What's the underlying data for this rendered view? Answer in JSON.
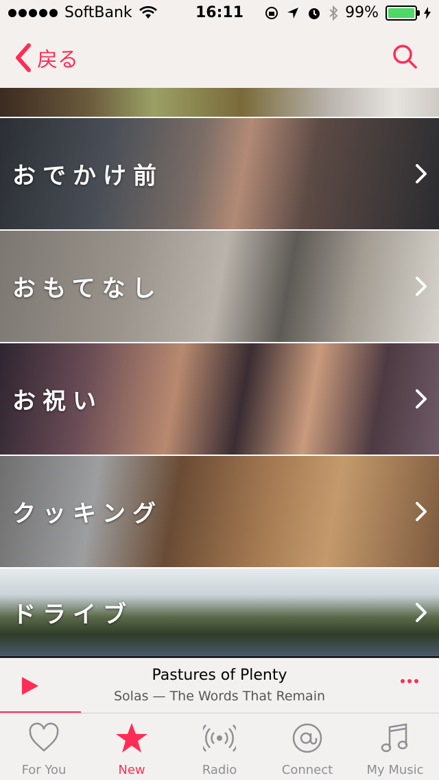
{
  "status_bar": {
    "carrier": "SoftBank",
    "time": "16:11",
    "battery": "99%",
    "battery_level": 0.99
  },
  "nav": {
    "back_label": "戻る"
  },
  "categories": [
    {
      "label": "おでかけ前"
    },
    {
      "label": "おもてなし"
    },
    {
      "label": "お祝い"
    },
    {
      "label": "クッキング"
    },
    {
      "label": "ドライブ"
    }
  ],
  "mini_player": {
    "title": "Pastures of Plenty",
    "subtitle": "Solas — The Words That Remain"
  },
  "tab_bar": {
    "tabs": [
      {
        "label": "For You",
        "icon": "heart-icon"
      },
      {
        "label": "New",
        "icon": "star-icon",
        "active": true
      },
      {
        "label": "Radio",
        "icon": "radio-icon"
      },
      {
        "label": "Connect",
        "icon": "at-icon"
      },
      {
        "label": "My Music",
        "icon": "music-note-icon"
      }
    ]
  },
  "colors": {
    "accent": "#ff2d55",
    "battery_fill": "#4cd964"
  }
}
